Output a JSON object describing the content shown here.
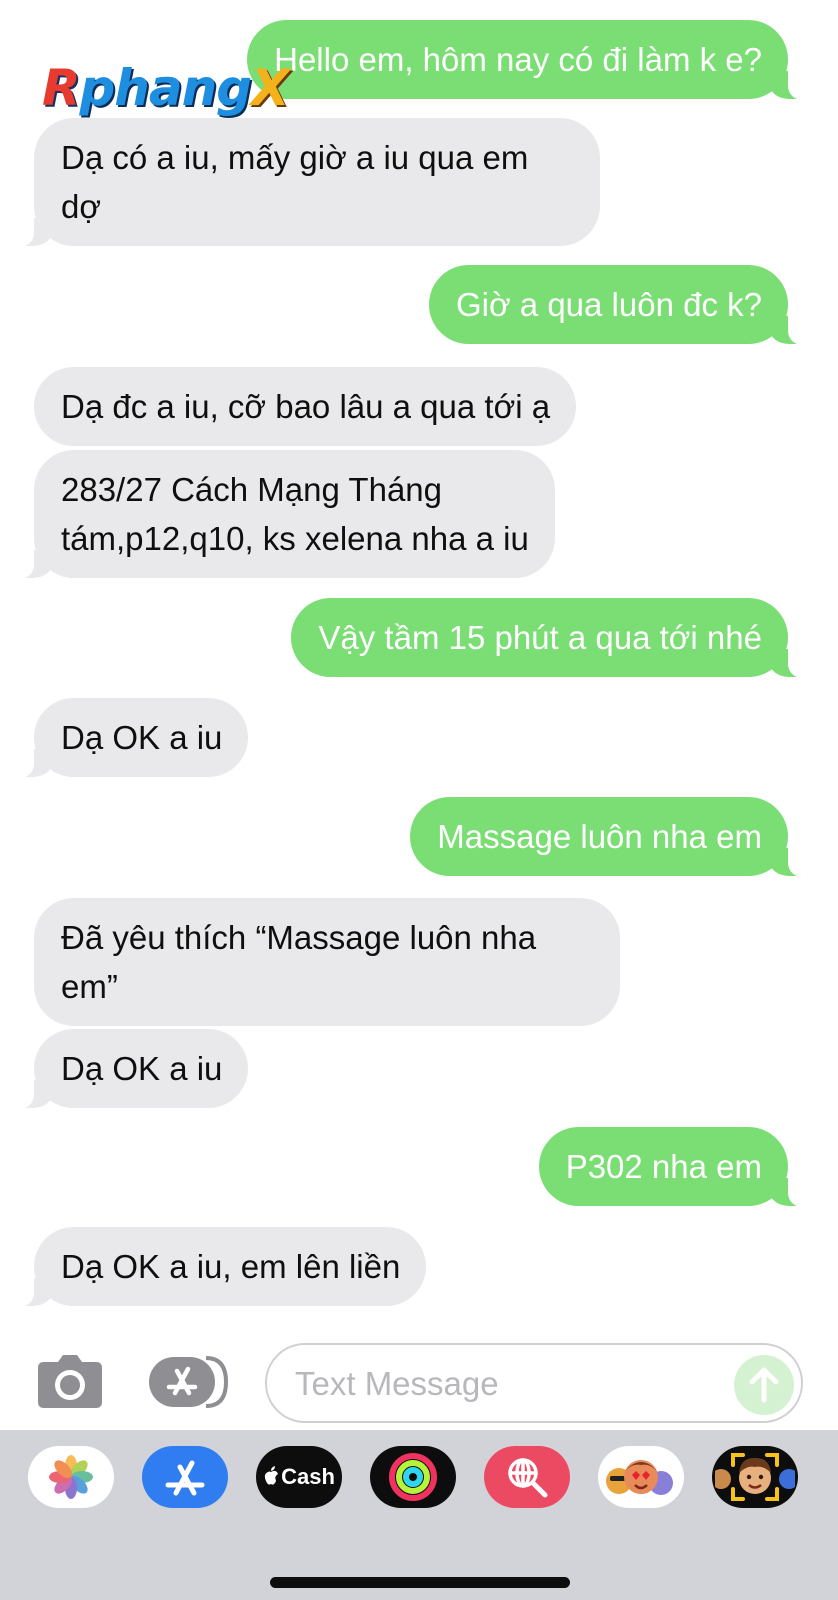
{
  "watermark": {
    "part1": "R",
    "part2": "phang",
    "part3": "X"
  },
  "messages": [
    {
      "direction": "outgoing",
      "text": "Hello em, hôm nay có đi làm k e?"
    },
    {
      "direction": "incoming",
      "text": "Dạ có a iu, mấy giờ a iu qua em\ndợ"
    },
    {
      "direction": "outgoing",
      "text": "Giờ a qua luôn đc k?"
    },
    {
      "direction": "incoming",
      "text": "Dạ đc a iu, cỡ bao lâu a qua tới ạ"
    },
    {
      "direction": "incoming",
      "text": "283/27 Cách Mạng Tháng\ntám,p12,q10, ks xelena nha a iu"
    },
    {
      "direction": "outgoing",
      "text": "Vậy tầm 15 phút a qua tới nhé"
    },
    {
      "direction": "incoming",
      "text": "Dạ OK a iu"
    },
    {
      "direction": "outgoing",
      "text": "Massage luôn nha em"
    },
    {
      "direction": "incoming",
      "text": "Đã yêu thích “Massage luôn nha\nem”"
    },
    {
      "direction": "incoming",
      "text": "Dạ OK a iu"
    },
    {
      "direction": "outgoing",
      "text": "P302 nha em"
    },
    {
      "direction": "incoming",
      "text": "Dạ OK a iu, em lên liền"
    }
  ],
  "input": {
    "placeholder": "Text Message",
    "value": ""
  },
  "apps": [
    {
      "name": "photos-app-icon"
    },
    {
      "name": "app-store-app-icon"
    },
    {
      "name": "apple-cash-app-icon",
      "label": "Cash"
    },
    {
      "name": "activity-app-icon"
    },
    {
      "name": "images-search-app-icon"
    },
    {
      "name": "memoji-stickers-app-icon"
    },
    {
      "name": "memoji-app-icon"
    }
  ],
  "colors": {
    "outgoing_bubble": "#7ade74",
    "incoming_bubble": "#e9e9eb",
    "drawer_background": "#d2d3d8",
    "send_button": "#d4f2d2"
  }
}
